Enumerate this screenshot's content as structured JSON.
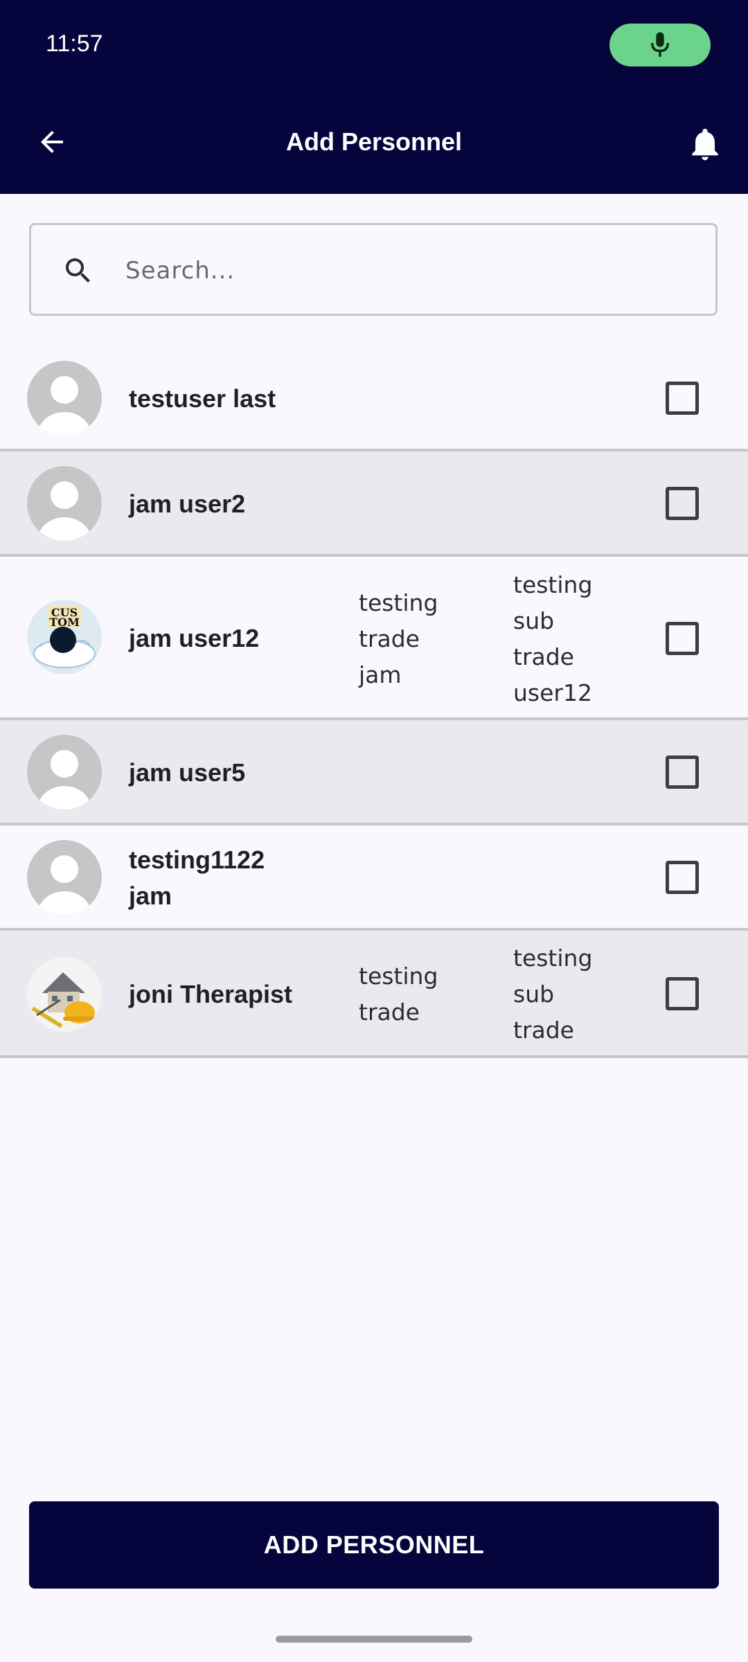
{
  "status_bar": {
    "time": "11:57",
    "mic_icon": "microphone-icon",
    "mic_color": "#6CD48A"
  },
  "app_bar": {
    "title": "Add Personnel",
    "back_icon": "arrow-left-icon",
    "notification_icon": "bell-icon",
    "background": "#06043C"
  },
  "search": {
    "placeholder": "Search...",
    "value": "",
    "icon": "search-icon"
  },
  "personnel": [
    {
      "name": "testuser last",
      "trade": "",
      "sub_trade": "",
      "avatar": "default-avatar",
      "checked": false
    },
    {
      "name": "jam user2",
      "trade": "",
      "sub_trade": "",
      "avatar": "default-avatar",
      "checked": false
    },
    {
      "name": "jam user12",
      "trade": "testing\ntrade\njam",
      "sub_trade": "testing\nsub\ntrade\nuser12",
      "avatar": "custom-logo-avatar",
      "checked": false
    },
    {
      "name": "jam user5",
      "trade": "",
      "sub_trade": "",
      "avatar": "default-avatar",
      "checked": false
    },
    {
      "name": "testing1122\njam",
      "trade": "",
      "sub_trade": "",
      "avatar": "default-avatar",
      "checked": false
    },
    {
      "name": "joni Therapist",
      "trade": "testing\ntrade",
      "sub_trade": "testing\nsub\ntrade",
      "avatar": "house-construction-avatar",
      "checked": false
    }
  ],
  "add_button": {
    "label": "ADD PERSONNEL"
  },
  "colors": {
    "primary": "#06043C",
    "background": "#FAF8FE",
    "row_alt": "#EBE9EF"
  }
}
